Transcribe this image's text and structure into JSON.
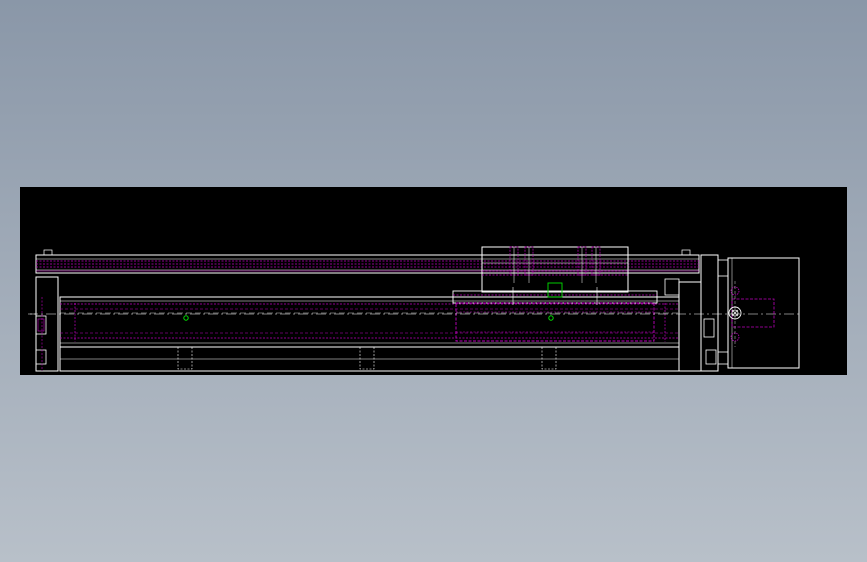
{
  "colors": {
    "bg_top": "#8a97a8",
    "bg_bottom": "#b8c0c9",
    "canvas": "#000000",
    "outline": "#ffffff",
    "hidden": "#c000c0",
    "accent": "#e040e0",
    "marker": "#00e000"
  }
}
